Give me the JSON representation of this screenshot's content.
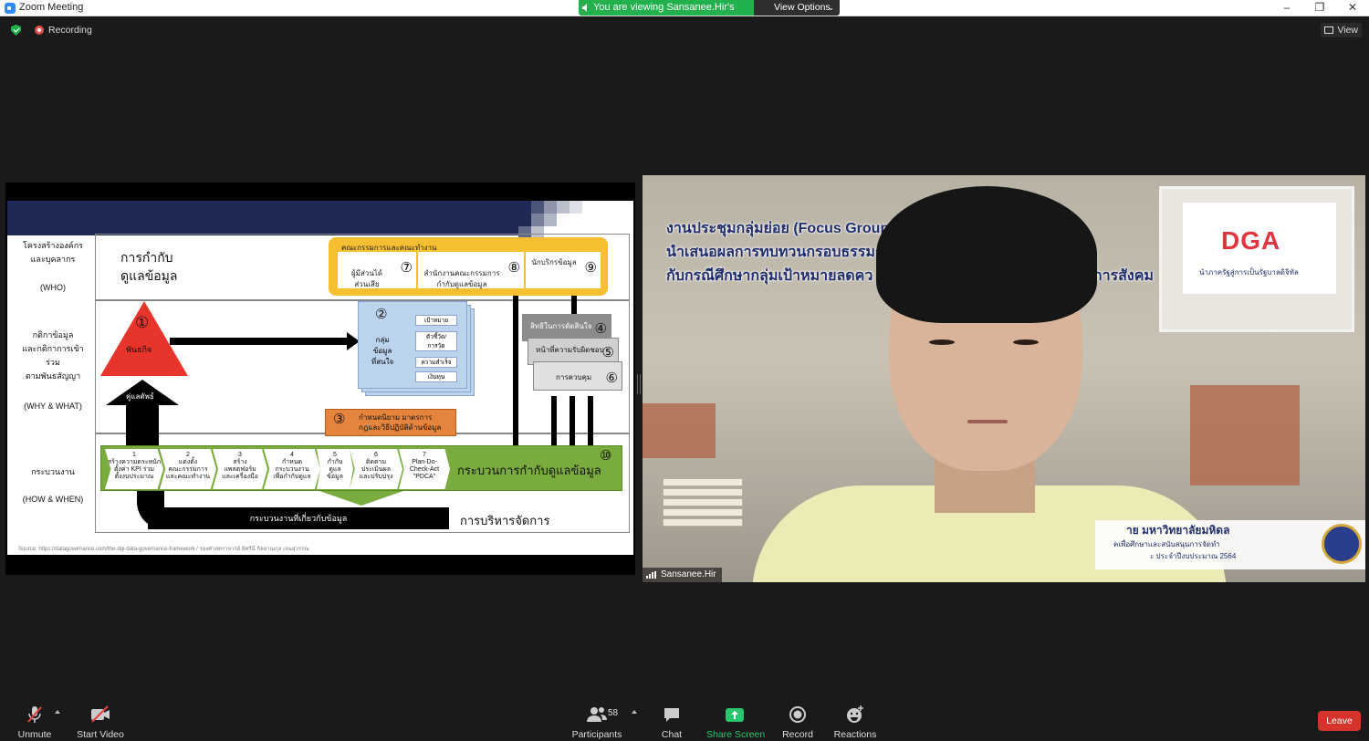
{
  "window": {
    "title": "Zoom Meeting",
    "viewing_banner": "You are viewing Sansanee.Hir's screen",
    "view_options": "View Options",
    "controls": [
      "–",
      "❐",
      "✕"
    ]
  },
  "meeting": {
    "recording_label": "Recording",
    "view_label": "View",
    "participant_name": "Sansanee.Hir"
  },
  "slide": {
    "left_labels": {
      "structure": "โครงสร้างองค์กร\nและบุคลากร",
      "who": "(WHO)",
      "strategy": "กติกาข้อมูล\nและกติกาการเข้า\nร่วม\nตามพันธสัญญา",
      "why_what": "(WHY & WHAT)",
      "process": "กระบวนงาน",
      "how_when": "(HOW & WHEN)"
    },
    "governance_title": "การกำกับ\nดูแลข้อมูล",
    "committee_head": "คณะกรรมการและคณะทำงาน",
    "committee_boxes": [
      {
        "text": "ผู้มีส่วนได้\nส่วนเสีย",
        "num": "⑦"
      },
      {
        "text": "สำนักงานคณะกรรมการ\nกำกับดูแลข้อมูล",
        "num": "⑧"
      },
      {
        "text": "นักบริกรข้อมูล",
        "num": "⑨"
      }
    ],
    "mission_num": "①",
    "mission_label": "พันธกิจ",
    "partner_label": "คู่แลตัพธ์",
    "group_num": "②",
    "group_label": "กลุ่ม\nข้อมูล\nที่สนใจ",
    "group_items": [
      "เป้าหมาย",
      "ตัวชี้วัด/\nการวัด",
      "ความสำเร็จ",
      "เงินทุน"
    ],
    "right_boxes": [
      {
        "text": "สิทธิในการตัดสินใจ",
        "num": "④"
      },
      {
        "text": "หน้าที่ความรับผิดชอบ",
        "num": "⑤"
      },
      {
        "text": "การควบคุม",
        "num": "⑥"
      }
    ],
    "rules_num": "③",
    "rules_label": "กำหนดนิยาม มาตรการ\nกฎและวิธีปฏิบัติด้านข้อมูล",
    "process_steps": [
      "1\nสร้างความตระหนัก\nตั้งค่า KPI ร่วม\nตั้งงบประมาณ",
      "2\nแต่งตั้ง\nคณะกรรมการ\nและคณะทำงาน",
      "3\nสร้าง\nแพลตฟอร์ม\nและเครื่องมือ",
      "4\nกำหนด\nกระบวนงาน\nเพื่อกำกับดูแล",
      "5\nกำกับ\nดูแล\nข้อมูล",
      "6\nติดตาม\nประเมินผล\nและปรับปรุง",
      "7\nPlan-Do-\nCheck-Act\n\"PDCA\""
    ],
    "process_num": "⑩",
    "process_title": "กระบวนการกำกับดูแลข้อมูล",
    "bottom_bar": "กระบวนงานที่เกี่ยวกับข้อมูล",
    "management": "การบริหารจัดการ",
    "source": "Source: https://datagovernance.com/the-dgi-data-governance-framework / รองศาสตราจารย์ อัครินี กัลยาณกุล เจนสุวรรณ"
  },
  "video": {
    "banner_lines": [
      "งานประชุมกลุ่มย่อย (Focus Group)                              8",
      "นำเสนอผลการทบทวนกรอบธรรมา",
      "กับกรณีศึกษากลุ่มเป้าหมายลดคว                                                    ดิการสังคม"
    ],
    "logo": "DGA",
    "logo_sub": "นำภาครัฐสู่การเป็นรัฐบาลดิจิทัล",
    "lower_third": [
      "าย มหาวิทยาลัยมหิดล",
      "คเพื่อศึกษาและสนับสนุนการจัดทำ",
      "ะ ประจำปีงบประมาณ 2564"
    ]
  },
  "toolbar": {
    "unmute": "Unmute",
    "start_video": "Start Video",
    "participants": "Participants",
    "participant_count": "58",
    "chat": "Chat",
    "share_screen": "Share Screen",
    "record": "Record",
    "reactions": "Reactions",
    "leave": "Leave"
  },
  "colors": {
    "banner_green": "#22b14c",
    "share_green": "#28c76f",
    "leave_red": "#d6332c",
    "slide_navy": "#1e2a55",
    "committee_yellow": "#f6bf32",
    "mission_red": "#e8352b",
    "process_green": "#7aab3f"
  }
}
